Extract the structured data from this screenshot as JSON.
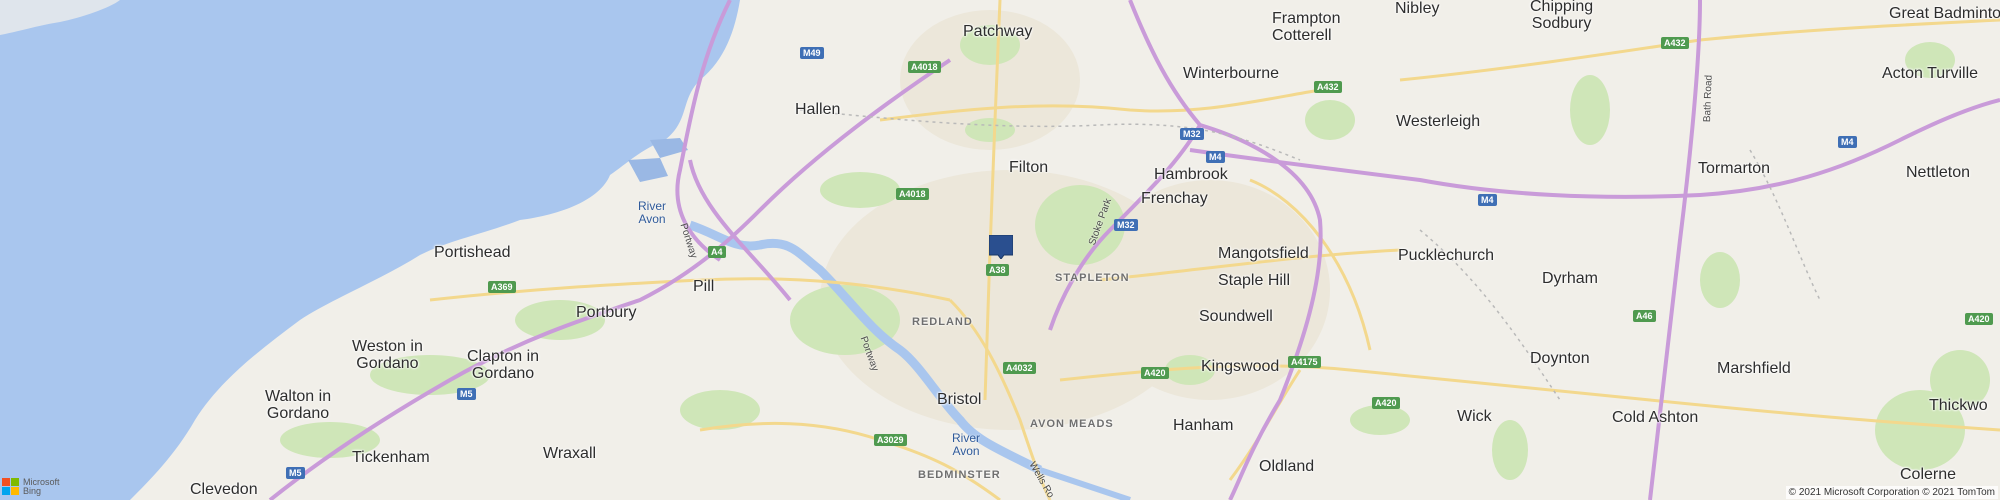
{
  "map": {
    "title": "",
    "colors": {
      "water": "#a9c6ee",
      "land": "#f1efe9",
      "motorway": "#c99bd9",
      "primary": "#f3d88d",
      "park": "#cfe6b8",
      "pin": "#2a4f8f"
    },
    "places": [
      {
        "name": "Patchway"
      },
      {
        "name": "Frampton\nCotterell"
      },
      {
        "name": "Nibley"
      },
      {
        "name": "Chipping\nSodbury"
      },
      {
        "name": "Great Badminton"
      },
      {
        "name": "Hallen"
      },
      {
        "name": "Winterbourne"
      },
      {
        "name": "Acton Turville"
      },
      {
        "name": "Westerleigh"
      },
      {
        "name": "Filton"
      },
      {
        "name": "Hambrook"
      },
      {
        "name": "Tormarton"
      },
      {
        "name": "Nettleton"
      },
      {
        "name": "Frenchay"
      },
      {
        "name": "Portishead"
      },
      {
        "name": "Mangotsfield"
      },
      {
        "name": "Pucklechurch"
      },
      {
        "name": "Pill"
      },
      {
        "name": "Portbury"
      },
      {
        "name": "Staple Hill"
      },
      {
        "name": "Dyrham"
      },
      {
        "name": "Soundwell"
      },
      {
        "name": "Weston in\nGordano"
      },
      {
        "name": "Clapton in\nGordano"
      },
      {
        "name": "Doynton"
      },
      {
        "name": "Kingswood"
      },
      {
        "name": "Marshfield"
      },
      {
        "name": "Walton in\nGordano"
      },
      {
        "name": "Bristol"
      },
      {
        "name": "Wick"
      },
      {
        "name": "Cold Ashton"
      },
      {
        "name": "Thickwo"
      },
      {
        "name": "Hanham"
      },
      {
        "name": "Wraxall"
      },
      {
        "name": "Tickenham"
      },
      {
        "name": "Oldland"
      },
      {
        "name": "Colerne"
      },
      {
        "name": "Clevedon"
      }
    ],
    "districts": [
      "REDLAND",
      "STAPLETON",
      "AVON MEADS",
      "BEDMINSTER"
    ],
    "water_labels": [
      "River\nAvon",
      "River\nAvon"
    ],
    "road_shields": [
      {
        "label": "M49",
        "type": "m"
      },
      {
        "label": "A4018",
        "type": "a"
      },
      {
        "label": "A432",
        "type": "a"
      },
      {
        "label": "M32",
        "type": "m"
      },
      {
        "label": "M4",
        "type": "m"
      },
      {
        "label": "A4018",
        "type": "a"
      },
      {
        "label": "A4",
        "type": "a"
      },
      {
        "label": "M32",
        "type": "m"
      },
      {
        "label": "A38",
        "type": "a"
      },
      {
        "label": "A369",
        "type": "a"
      },
      {
        "label": "M4",
        "type": "m"
      },
      {
        "label": "A432",
        "type": "a"
      },
      {
        "label": "M4",
        "type": "m"
      },
      {
        "label": "A46",
        "type": "a"
      },
      {
        "label": "A420",
        "type": "a"
      },
      {
        "label": "A4175",
        "type": "a"
      },
      {
        "label": "A4032",
        "type": "a"
      },
      {
        "label": "A420",
        "type": "a"
      },
      {
        "label": "A420",
        "type": "a"
      },
      {
        "label": "M5",
        "type": "m"
      },
      {
        "label": "A3029",
        "type": "a"
      },
      {
        "label": "M5",
        "type": "m"
      }
    ],
    "road_names": [
      "Portway",
      "Stoke Park",
      "Portway",
      "Bath Road",
      "Wells Ro"
    ],
    "pin": {
      "name": "location-pin",
      "color": "#2a4f8f"
    },
    "logo": {
      "line1": "Microsoft",
      "line2": "Bing"
    },
    "attribution": "© 2021 Microsoft Corporation © 2021 TomTom"
  }
}
